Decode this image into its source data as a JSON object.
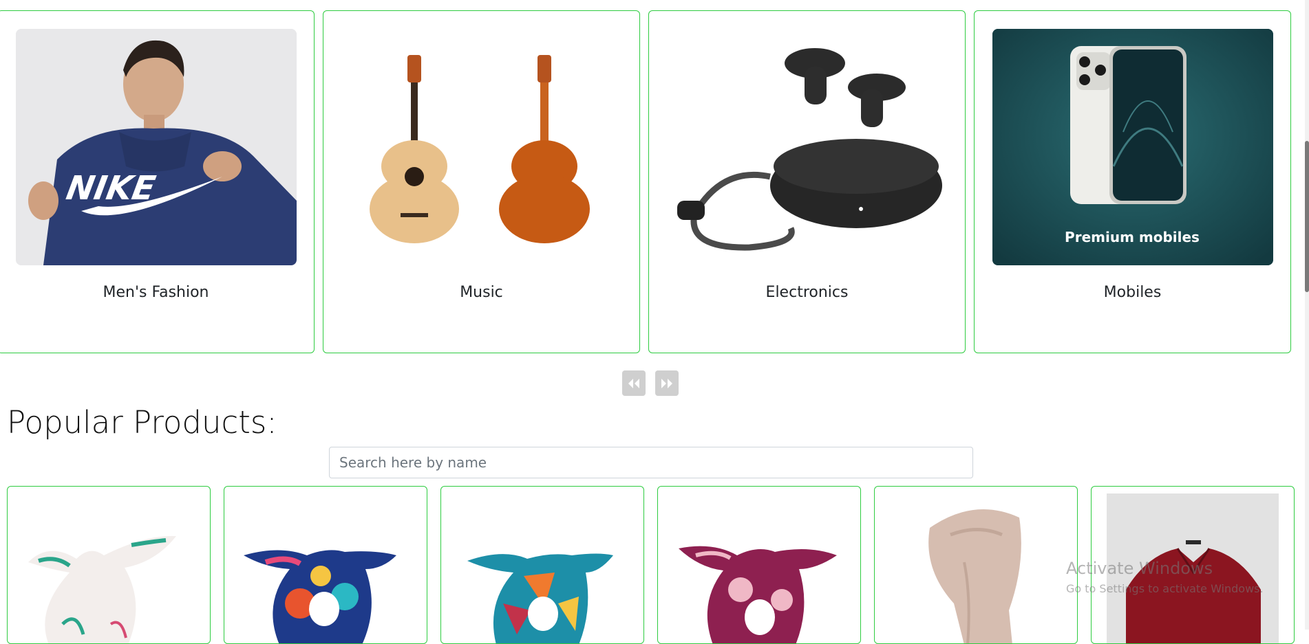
{
  "categories": [
    {
      "label": "Men's Fashion",
      "image": "hoodie-photo"
    },
    {
      "label": "Music",
      "image": "guitar-photo"
    },
    {
      "label": "Electronics",
      "image": "earbuds-photo"
    },
    {
      "label": "Mobiles",
      "image": "phone-photo",
      "overlay_text": "Premium mobiles"
    }
  ],
  "carousel": {
    "prev_icon": "double-chevron-left-icon",
    "next_icon": "double-chevron-right-icon"
  },
  "popular": {
    "title": "Popular Products:",
    "search_placeholder": "Search here by name"
  },
  "products": [
    {
      "image": "scarf-white-green"
    },
    {
      "image": "scarf-multicolor"
    },
    {
      "image": "scarf-geometric"
    },
    {
      "image": "scarf-pink-floral"
    },
    {
      "image": "scarf-beige"
    },
    {
      "image": "maroon-shirt"
    }
  ],
  "watermark": {
    "title": "Activate Windows",
    "subtitle": "Go to Settings to activate Windows."
  },
  "colors": {
    "card_border": "#2ecc40",
    "nav_button": "#cfcfcf",
    "phone_bg": "#1f4f55"
  }
}
